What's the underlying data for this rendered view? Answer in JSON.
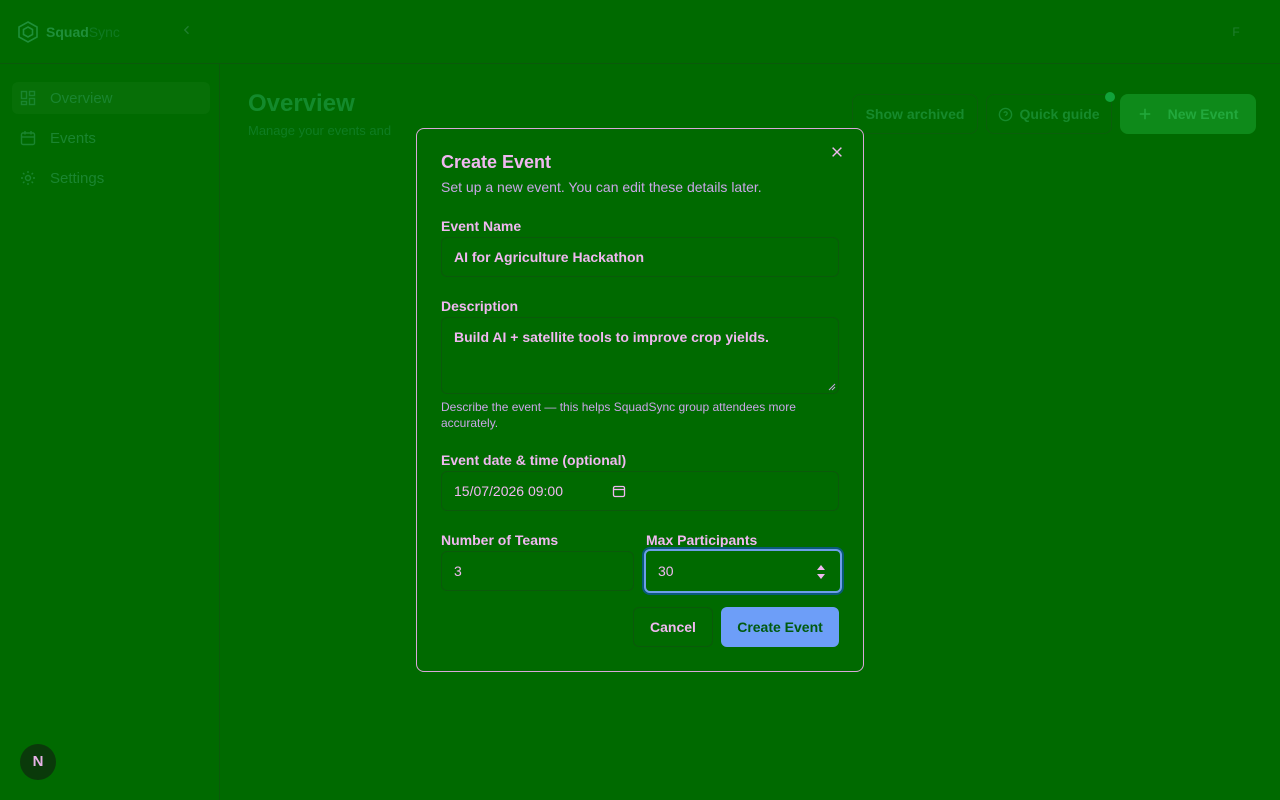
{
  "app": {
    "brand_primary": "Squad",
    "brand_secondary": "Sync",
    "user_initial": "F"
  },
  "sidebar": {
    "items": [
      {
        "label": "Overview",
        "icon": "dashboard-icon",
        "active": true
      },
      {
        "label": "Events",
        "icon": "calendar-icon",
        "active": false
      },
      {
        "label": "Settings",
        "icon": "gear-icon",
        "active": false
      }
    ]
  },
  "main": {
    "title": "Overview",
    "subtitle": "Manage your events and"
  },
  "header_actions": {
    "show_archived": "Show archived",
    "quick_guide": "Quick guide",
    "new_event": "New Event"
  },
  "next_badge": "N",
  "modal": {
    "title": "Create Event",
    "subtitle": "Set up a new event. You can edit these details later.",
    "event_name": {
      "label": "Event Name",
      "value": "AI for Agriculture Hackathon"
    },
    "description": {
      "label": "Description",
      "value": "Build AI + satellite tools to improve crop yields.",
      "help": "Describe the event — this helps SquadSync group attendees more accurately."
    },
    "event_datetime": {
      "label": "Event date & time (optional)",
      "value": "15/07/2026 09:00"
    },
    "num_teams": {
      "label": "Number of Teams",
      "value": "3"
    },
    "max_participants": {
      "label": "Max Participants",
      "value": "30"
    },
    "cancel_label": "Cancel",
    "create_label": "Create Event"
  },
  "colors": {
    "background": "#006a00",
    "text": "#f0b8f0",
    "primary_button": "#6d9ef8",
    "focus_ring": "#6d9ee8"
  }
}
